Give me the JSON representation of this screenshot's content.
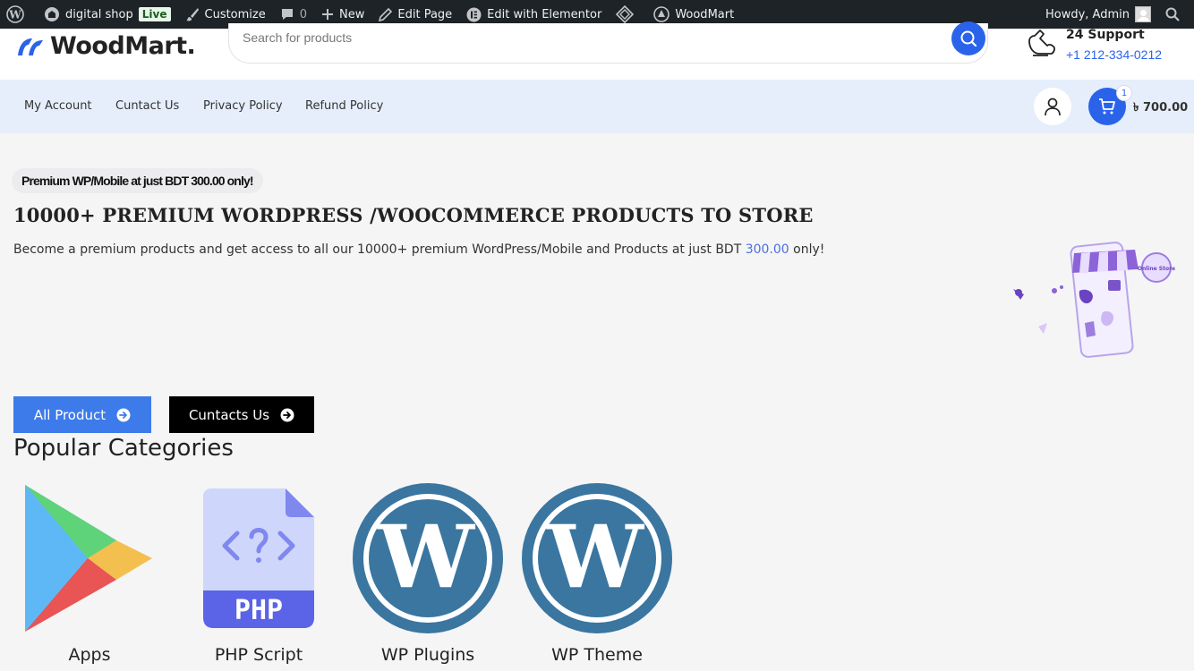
{
  "adminbar": {
    "site_name": "digital shop",
    "live_badge": "Live",
    "customize": "Customize",
    "comments_count": "0",
    "new": "New",
    "edit_page": "Edit Page",
    "edit_elementor": "Edit with Elementor",
    "woodmart": "WoodMart",
    "howdy": "Howdy, Admin"
  },
  "header": {
    "logo_text": "WoodMart.",
    "search_placeholder": "Search for products",
    "support_title": "24 Support",
    "support_phone": "+1 212-334-0212"
  },
  "nav": {
    "items": [
      "My Account",
      "Cuntact Us",
      "Privacy Policy",
      "Refund Policy"
    ],
    "cart_count": "1",
    "cart_total": "৳ 700.00"
  },
  "hero": {
    "badge": "Premium WP/Mobile at just BDT 300.00 only!",
    "title": "10000+ PREMIUM WORDPRESS /WOOCOMMERCE PRODUCTS TO STORE",
    "text_before": "Become a premium products and get access to all our 10000+ premium WordPress/Mobile and Products at just BDT ",
    "price": "300.00",
    "text_after": " only!",
    "art_label": "Online Store",
    "btn_all": "All Product",
    "btn_contact": "Cuntacts Us"
  },
  "categories": {
    "heading": "Popular Categories",
    "items": [
      {
        "label": "Apps",
        "icon": "google-play-icon"
      },
      {
        "label": "PHP Script",
        "icon": "php-file-icon"
      },
      {
        "label": "WP Plugins",
        "icon": "wordpress-icon"
      },
      {
        "label": "WP Theme",
        "icon": "wordpress-icon"
      }
    ]
  },
  "colors": {
    "admin_bar": "#1d2327",
    "accent_blue": "#2a63ea",
    "nav_bg": "#e6eefb",
    "wp_blue": "#3a76a0"
  }
}
